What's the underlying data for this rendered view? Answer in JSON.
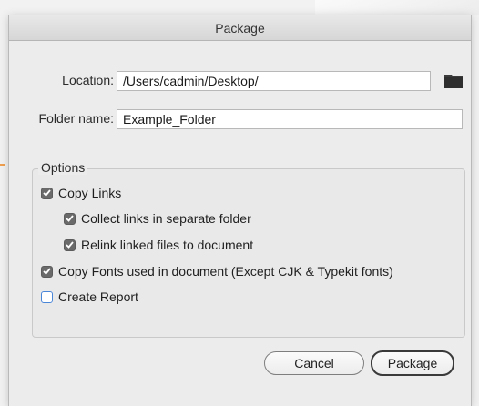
{
  "dialog": {
    "title": "Package"
  },
  "location": {
    "label": "Location:",
    "value": "/Users/cadmin/Desktop/"
  },
  "folder_name": {
    "label": "Folder name:",
    "value": "Example_Folder"
  },
  "options": {
    "title": "Options",
    "copy_links": {
      "label": "Copy Links",
      "checked": true
    },
    "collect_links": {
      "label": "Collect links in separate folder",
      "checked": true
    },
    "relink_files": {
      "label": "Relink linked files to document",
      "checked": true
    },
    "copy_fonts": {
      "label": "Copy Fonts used in document (Except CJK & Typekit fonts)",
      "checked": true
    },
    "create_report": {
      "label": "Create Report",
      "checked": false
    }
  },
  "buttons": {
    "cancel": "Cancel",
    "package": "Package"
  },
  "icons": {
    "browse": "folder-icon",
    "check": "checkmark-icon"
  },
  "colors": {
    "unchecked_border": "#4a86d8",
    "checked_fill": "#6a6a6a"
  }
}
